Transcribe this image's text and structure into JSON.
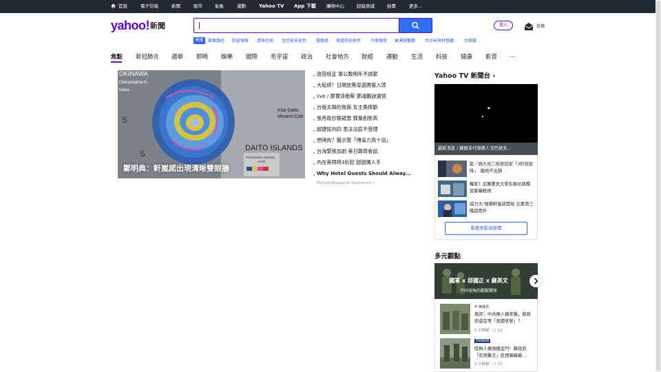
{
  "topnav": {
    "items": [
      "首頁",
      "電子信箱",
      "新聞",
      "股市",
      "氣象",
      "運動",
      "Yahoo TV",
      "App 下載",
      "購物中心",
      "超級商城",
      "拍賣",
      "更多..."
    ]
  },
  "logo": {
    "brand": "yahoo!",
    "section": "新聞"
  },
  "search": {
    "value": "",
    "icon": "search-icon"
  },
  "trending": {
    "tag": "熱搜",
    "items": [
      "颱風路徑",
      "防疫保險",
      "清境住宿",
      "戈巴契夫逝世",
      "電豬塔",
      "搖盛和夫辭世",
      "汽車報修",
      "東湧賞鑿鵝",
      "台中米其林餐廳",
      "台積電"
    ]
  },
  "account": {
    "login": "登入",
    "mail": "信箱"
  },
  "categories": [
    "焦點",
    "新冠肺炎",
    "選舉",
    "即時",
    "娛樂",
    "國際",
    "毛宇宙",
    "政治",
    "社會地方",
    "財經",
    "運動",
    "生活",
    "科技",
    "健康",
    "影音",
    "..."
  ],
  "hero": {
    "caption": "鄭明典：軒嵐諾出現清晰雙眼牆",
    "map_labels": [
      "OKINAWA",
      "Okinawajima Is.",
      "nawa",
      "Kita-Daito",
      "Minami-Dait",
      "DAITO ISLANDS",
      "Precipitation Intensity",
      "mm/h",
      "S",
      "S"
    ]
  },
  "headlines": [
    "政院核定 軍公教明年不調薪",
    "大鬆綁！日開放無導遊團客入境",
    "live / 鄭寶清衝擊 鄭運鵬說選情",
    "台版太陽的後裔 女主角摔斷",
    "張善政抄襲疑雲 聲量創新高",
    "超捷銘列四 墨法法庭不受理",
    "想烤肉？醫示警「傳染力高十倍」",
    "台海緊張加劇 美日韓齊會談",
    "內在美限時3折起 甜甜價入手",
    "Why Hotel Guests Should Alway..."
  ],
  "sponsor": {
    "source": "MyDailyMagazine",
    "label": "Sponsored"
  },
  "yahoo_tv": {
    "title": "Yahoo TV 新聞台",
    "latest": "最新消息 / 蘇聯末代領導人戈巴契夫...",
    "items": [
      "影／佩大見二哈拒回家「3秒就投降」　龍地不出鍋",
      "獨家》武羅驚見大學生聯玩興種 遊客嚇輕視",
      "威力大!強襲軒嵐諾開始 北東南三晚超雨炸"
    ],
    "more": "看更多影音新聞"
  },
  "opinions": {
    "title": "多元觀點",
    "banner_title": "國軍 x 邱國正 x 蘇英文",
    "banner_sub": "不同視角的觀觀獨享",
    "items": [
      {
        "source": "美麗島",
        "text": "風評：中共無人機來襲，蔡政府還在等「美國老爹」？",
        "time": "5 小時前",
        "comments": "12"
      },
      {
        "source": "TAIWAN",
        "text": "陸無人機頻擾金門！蘇政府「有努難言」反煙嚇嚇離...",
        "time": "2 小時前",
        "comments": "27"
      }
    ]
  }
}
